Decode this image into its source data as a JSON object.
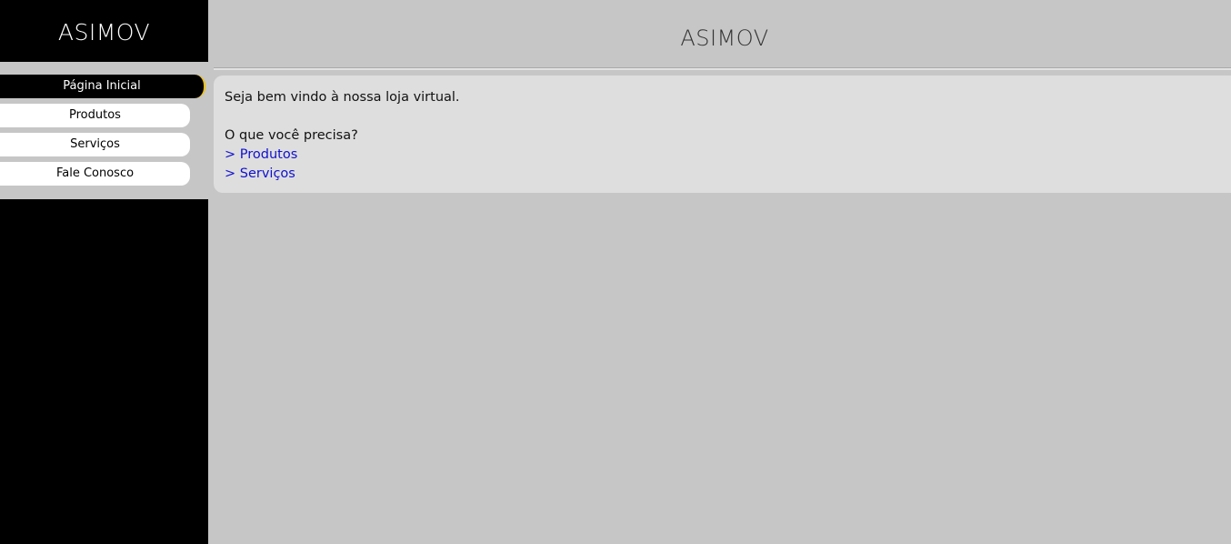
{
  "sidebar": {
    "logo": "ASIMOV",
    "menu": [
      {
        "label": "Página Inicial",
        "active": true
      },
      {
        "label": "Produtos",
        "active": false
      },
      {
        "label": "Serviços",
        "active": false
      },
      {
        "label": "Fale Conosco",
        "active": false
      }
    ]
  },
  "header": {
    "title": "ASIMOV"
  },
  "content": {
    "welcome": "Seja bem vindo à nossa loja virtual.",
    "question": "O que você precisa?",
    "links": [
      {
        "label": "> Produtos"
      },
      {
        "label": "> Serviços"
      }
    ]
  },
  "colors": {
    "sidebar_bg": "#000000",
    "page_bg": "#c6c6c6",
    "content_bg": "#dedede",
    "active_accent": "#f0c000",
    "link": "#1010d0"
  }
}
